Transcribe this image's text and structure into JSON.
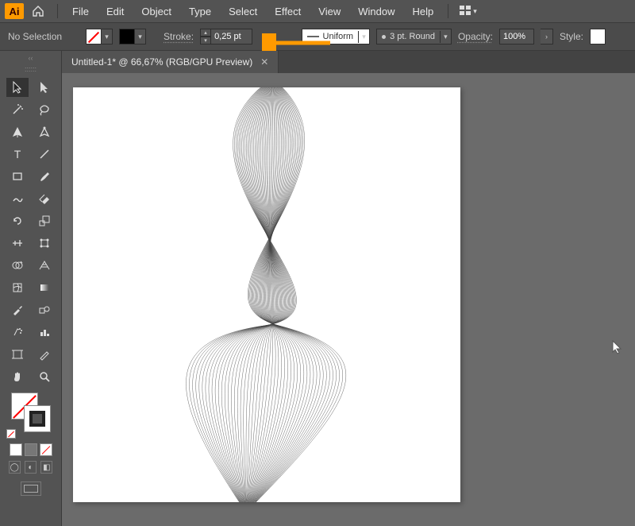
{
  "menubar": {
    "items": [
      "File",
      "Edit",
      "Object",
      "Type",
      "Select",
      "Effect",
      "View",
      "Window",
      "Help"
    ]
  },
  "options": {
    "selection_label": "No Selection",
    "stroke_label": "Stroke:",
    "stroke_value": "0,25 pt",
    "profile_label": "Uniform",
    "brush_label": "3 pt. Round",
    "opacity_label": "Opacity:",
    "opacity_value": "100%",
    "style_label": "Style:"
  },
  "document": {
    "tab_title": "Untitled-1* @ 66,67% (RGB/GPU Preview)"
  }
}
